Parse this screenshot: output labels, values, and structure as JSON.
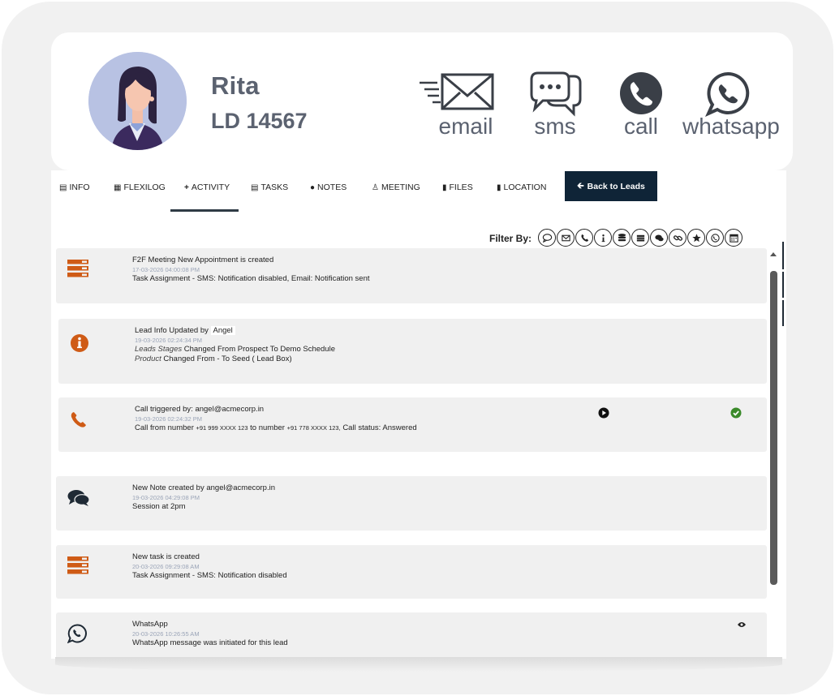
{
  "lead": {
    "name": "Rita",
    "id": "LD 14567"
  },
  "contacts": {
    "email": "email",
    "sms": "sms",
    "call": "call",
    "whatsapp": "whatsapp"
  },
  "tabs": [
    {
      "label": "INFO"
    },
    {
      "label": "FLEXILOG"
    },
    {
      "label": "ACTIVITY"
    },
    {
      "label": "TASKS"
    },
    {
      "label": "NOTES"
    },
    {
      "label": "MEETING"
    },
    {
      "label": "FILES"
    },
    {
      "label": "LOCATION"
    }
  ],
  "active_tab": "ACTIVITY",
  "back_button": "Back to Leads",
  "filter_label": "Filter By:",
  "filter_icons": [
    "chat-bubble-icon",
    "envelope-icon",
    "phone-icon",
    "info-icon",
    "database-icon",
    "task-icon",
    "comments-icon",
    "link-icon",
    "star-icon",
    "whatsapp-icon",
    "calendar-icon"
  ],
  "colors": {
    "accent_orange": "#cf5b16",
    "navy": "#0f2437",
    "heading_grey": "#5b6270",
    "timestamp": "#9aa4b7",
    "success_green": "#3a8a2a"
  },
  "activities": [
    {
      "icon": "task-icon",
      "title": "F2F Meeting New Appointment is created",
      "timestamp": "17-03-2026 04:00:08 PM",
      "detail": "Task Assignment - SMS: Notification disabled, Email: Notification sent"
    },
    {
      "icon": "info-icon",
      "title_prefix": "Lead Info Updated by",
      "title_user": "Angel",
      "timestamp": "19-03-2026 02:24:34 PM",
      "line1_field": "Leads Stages",
      "line1_text": "Changed From Prospect To Demo Schedule",
      "line2_field": "Product",
      "line2_text": "Changed From - To Seed ( Lead Box)"
    },
    {
      "icon": "phone-icon",
      "title_prefix": "Call triggered by:",
      "title_user": "angel@acmecorp.in",
      "timestamp": "19-03-2026 02:24:32 PM",
      "detail_prefix": "Call from number",
      "from_number": "+91 999 XXXX 123",
      "detail_mid": "to number",
      "to_number": "+91 778 XXXX 123,",
      "detail_status": "Call status: Answered"
    },
    {
      "icon": "comments-icon",
      "title_prefix": "New Note created by",
      "title_user": "angel@acmecorp.in",
      "timestamp": "19-03-2026 04:29:08 PM",
      "detail": "Session at 2pm"
    },
    {
      "icon": "task-icon",
      "title": "New task is created",
      "timestamp": "20-03-2026 09:29:08 AM",
      "detail": "Task Assignment - SMS: Notification disabled"
    },
    {
      "icon": "whatsapp-icon",
      "title": "WhatsApp",
      "timestamp": "20-03-2026 10:26:55 AM",
      "detail": "WhatsApp message was initiated for this lead"
    }
  ]
}
